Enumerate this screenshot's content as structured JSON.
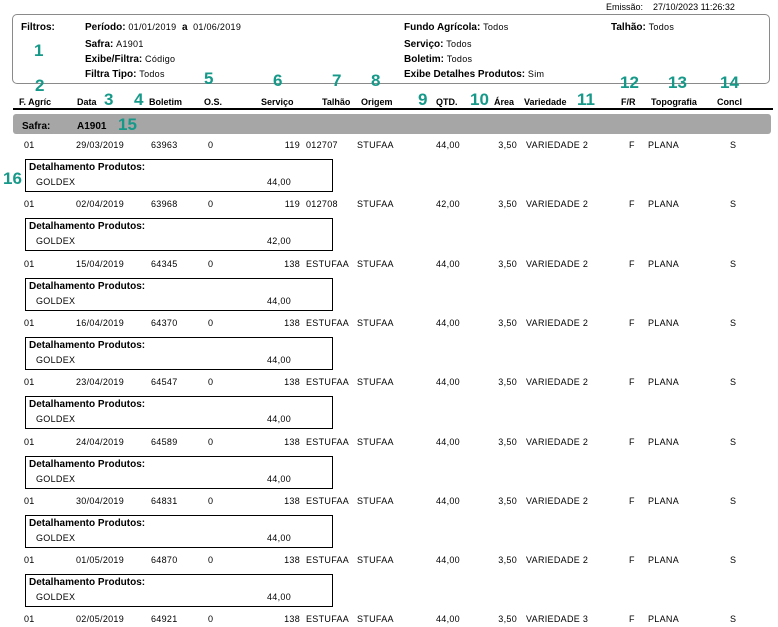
{
  "emissao": {
    "label": "Emissão:",
    "value": "27/10/2023  11:26:32"
  },
  "filters": {
    "title": "Filtros:",
    "periodo_label": "Período:",
    "periodo_start": "01/01/2019",
    "periodo_sep": "a",
    "periodo_end": "01/06/2019",
    "safra_label": "Safra:",
    "safra_value": "A1901",
    "exibe_label": "Exibe/Filtra:",
    "exibe_value": "Código",
    "filtra_label": "Filtra Tipo:",
    "filtra_value": "Todos",
    "fundo_label": "Fundo Agrícola:",
    "fundo_value": "Todos",
    "servico_label": "Serviço:",
    "servico_value": "Todos",
    "boletim_label": "Boletim:",
    "boletim_value": "Todos",
    "detalhes_label": "Exibe Detalhes Produtos:",
    "detalhes_value": "Sim",
    "talhao_label": "Talhão:",
    "talhao_value": "Todos"
  },
  "columns": {
    "fagric": "F. Agríc",
    "data": "Data",
    "boletim": "Boletim",
    "os": "O.S.",
    "servico": "Serviço",
    "talhao": "Talhão",
    "origem": "Origem",
    "qtd": "QTD.",
    "area": "Área",
    "variedade": "Variedade",
    "fr": "F/R",
    "topografia": "Topografia",
    "concl": "Concl"
  },
  "safra": {
    "label": "Safra:",
    "value": "A1901"
  },
  "detail_title": "Detalhamento Produtos:",
  "rows": [
    {
      "fagric": "01",
      "data": "29/03/2019",
      "boletim": "63963",
      "os": "0",
      "servico": "119",
      "talhao": "012707",
      "origem": "STUFAA",
      "qtd": "44,00",
      "area": "3,50",
      "variedade": "VARIEDADE 2",
      "fr": "F",
      "topografia": "PLANA",
      "concl": "S",
      "produto": "GOLDEX",
      "prod_qtd": "44,00"
    },
    {
      "fagric": "01",
      "data": "02/04/2019",
      "boletim": "63968",
      "os": "0",
      "servico": "119",
      "talhao": "012708",
      "origem": "STUFAA",
      "qtd": "42,00",
      "area": "3,50",
      "variedade": "VARIEDADE 2",
      "fr": "F",
      "topografia": "PLANA",
      "concl": "S",
      "produto": "GOLDEX",
      "prod_qtd": "42,00"
    },
    {
      "fagric": "01",
      "data": "15/04/2019",
      "boletim": "64345",
      "os": "0",
      "servico": "138",
      "talhao": "ESTUFAA",
      "origem": "STUFAA",
      "qtd": "44,00",
      "area": "3,50",
      "variedade": "VARIEDADE 2",
      "fr": "F",
      "topografia": "PLANA",
      "concl": "S",
      "produto": "GOLDEX",
      "prod_qtd": "44,00"
    },
    {
      "fagric": "01",
      "data": "16/04/2019",
      "boletim": "64370",
      "os": "0",
      "servico": "138",
      "talhao": "ESTUFAA",
      "origem": "STUFAA",
      "qtd": "44,00",
      "area": "3,50",
      "variedade": "VARIEDADE 2",
      "fr": "F",
      "topografia": "PLANA",
      "concl": "S",
      "produto": "GOLDEX",
      "prod_qtd": "44,00"
    },
    {
      "fagric": "01",
      "data": "23/04/2019",
      "boletim": "64547",
      "os": "0",
      "servico": "138",
      "talhao": "ESTUFAA",
      "origem": "STUFAA",
      "qtd": "44,00",
      "area": "3,50",
      "variedade": "VARIEDADE 2",
      "fr": "F",
      "topografia": "PLANA",
      "concl": "S",
      "produto": "GOLDEX",
      "prod_qtd": "44,00"
    },
    {
      "fagric": "01",
      "data": "24/04/2019",
      "boletim": "64589",
      "os": "0",
      "servico": "138",
      "talhao": "ESTUFAA",
      "origem": "STUFAA",
      "qtd": "44,00",
      "area": "3,50",
      "variedade": "VARIEDADE 2",
      "fr": "F",
      "topografia": "PLANA",
      "concl": "S",
      "produto": "GOLDEX",
      "prod_qtd": "44,00"
    },
    {
      "fagric": "01",
      "data": "30/04/2019",
      "boletim": "64831",
      "os": "0",
      "servico": "138",
      "talhao": "ESTUFAA",
      "origem": "STUFAA",
      "qtd": "44,00",
      "area": "3,50",
      "variedade": "VARIEDADE 2",
      "fr": "F",
      "topografia": "PLANA",
      "concl": "S",
      "produto": "GOLDEX",
      "prod_qtd": "44,00"
    },
    {
      "fagric": "01",
      "data": "01/05/2019",
      "boletim": "64870",
      "os": "0",
      "servico": "138",
      "talhao": "ESTUFAA",
      "origem": "STUFAA",
      "qtd": "44,00",
      "area": "3,50",
      "variedade": "VARIEDADE 2",
      "fr": "F",
      "topografia": "PLANA",
      "concl": "S",
      "produto": "GOLDEX",
      "prod_qtd": "44,00"
    },
    {
      "fagric": "01",
      "data": "02/05/2019",
      "boletim": "64921",
      "os": "0",
      "servico": "138",
      "talhao": "ESTUFAA",
      "origem": "STUFAA",
      "qtd": "44,00",
      "area": "3,50",
      "variedade": "VARIEDADE 3",
      "fr": "F",
      "topografia": "PLANA",
      "concl": "S"
    }
  ],
  "callouts": [
    "1",
    "2",
    "3",
    "4",
    "5",
    "6",
    "7",
    "8",
    "9",
    "10",
    "11",
    "12",
    "13",
    "14",
    "15",
    "16"
  ],
  "colors": {
    "callout": "#17998a",
    "band": "#a6a6a6"
  }
}
